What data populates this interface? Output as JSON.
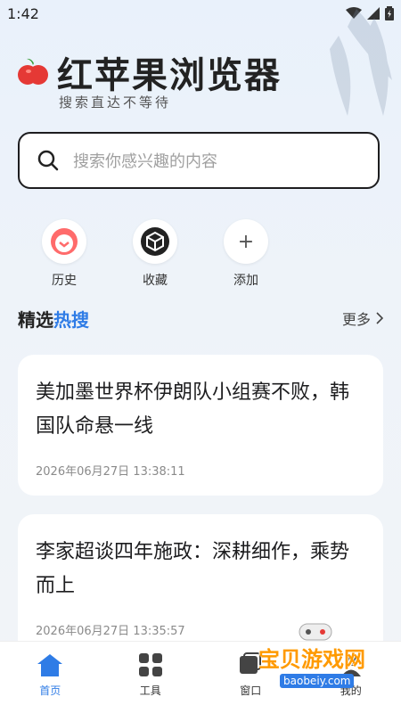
{
  "status": {
    "time": "1:42"
  },
  "header": {
    "title": "红苹果浏览器",
    "subtitle": "搜索直达不等待"
  },
  "search": {
    "placeholder": "搜索你感兴趣的内容"
  },
  "quick_actions": [
    {
      "label": "历史",
      "icon": "clock-icon"
    },
    {
      "label": "收藏",
      "icon": "box-icon"
    },
    {
      "label": "添加",
      "icon": "plus-icon"
    }
  ],
  "section": {
    "title_prefix": "精选",
    "title_highlight": "热搜",
    "more_label": "更多"
  },
  "news": [
    {
      "title": "美加墨世界杯伊朗队小组赛不败，韩国队命悬一线",
      "time": "2026年06月27日 13:38:11"
    },
    {
      "title": "李家超谈四年施政：深耕细作，乘势而上",
      "time": "2026年06月27日 13:35:57"
    }
  ],
  "tabbar": [
    {
      "label": "首页",
      "icon": "home-icon",
      "active": true
    },
    {
      "label": "工具",
      "icon": "grid-icon",
      "active": false
    },
    {
      "label": "窗口",
      "icon": "window-icon",
      "active": false
    },
    {
      "label": "我的",
      "icon": "user-icon",
      "active": false
    }
  ],
  "watermark": {
    "text": "宝贝游戏网",
    "url": "baobeiy.com"
  },
  "colors": {
    "accent": "#2f7ce6",
    "apple": "#e53935"
  }
}
